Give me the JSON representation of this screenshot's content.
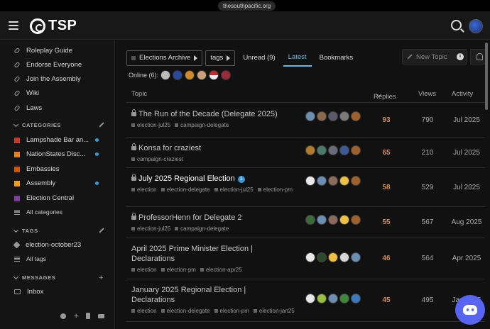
{
  "browser": {
    "url": "thesouthpacific.org"
  },
  "header": {
    "logo_text": "TSP"
  },
  "sidebar": {
    "links": [
      "Roleplay Guide",
      "Endorse Everyone",
      "Join the Assembly",
      "Wiki",
      "Laws"
    ],
    "categories_heading": "CATEGORIES",
    "categories": [
      {
        "label": "Lampshade Bar an...",
        "color": "#c0392b",
        "dot": true
      },
      {
        "label": "NationStates Disc...",
        "color": "#e67e22",
        "dot": true
      },
      {
        "label": "Embassies",
        "color": "#d35400",
        "dot": false
      },
      {
        "label": "Assembly",
        "color": "#f39c12",
        "dot": true
      },
      {
        "label": "Election Central",
        "color": "#7d3c98",
        "dot": false
      }
    ],
    "all_categories": "All categories",
    "tags_heading": "TAGS",
    "tags": [
      "election-october23"
    ],
    "all_tags": "All tags",
    "messages_heading": "MESSAGES",
    "inbox": "Inbox"
  },
  "nav": {
    "category_dropdown": "Elections Archive",
    "tags_dropdown": "tags",
    "tabs": [
      "Unread (9)",
      "Latest",
      "Bookmarks"
    ],
    "active_tab": "Latest",
    "new_topic": "New Topic"
  },
  "online": {
    "label": "Online (6):"
  },
  "table": {
    "headers": {
      "topic": "Topic",
      "replies": "Replies",
      "views": "Views",
      "activity": "Activity"
    },
    "rows": [
      {
        "title": "The Run of the Decade (Delegate 2025)",
        "locked": true,
        "bold": false,
        "badge": "",
        "tags": [
          "election-jul25",
          "campaign-delegate"
        ],
        "replies": "93",
        "views": "790",
        "activity": "Jul 2025",
        "posters": [
          "#6b8fb3",
          "#8a6a4a",
          "#5a5a6a",
          "#7a7a7a",
          "#a0602a"
        ]
      },
      {
        "title": "Konsa for craziest",
        "locked": true,
        "bold": false,
        "badge": "",
        "tags": [
          "campaign-craziest"
        ],
        "replies": "65",
        "views": "210",
        "activity": "Jul 2025",
        "posters": [
          "#b07a2a",
          "#4a7a6a",
          "#6a6a7a",
          "#3a5a9a",
          "#a0602a"
        ]
      },
      {
        "title": "July 2025 Regional Election",
        "locked": true,
        "bold": true,
        "badge": "1",
        "tags": [
          "election",
          "election-delegate",
          "election-jul25",
          "election-pm"
        ],
        "replies": "58",
        "views": "529",
        "activity": "Jul 2025",
        "posters": [
          "#e8e8e8",
          "#6b8fb3",
          "#8a6a5a",
          "#f0c040",
          "#a0602a"
        ]
      },
      {
        "title": "ProfessorHenn for Delegate 2",
        "locked": true,
        "bold": false,
        "badge": "",
        "tags": [
          "election-jul25",
          "campaign-delegate"
        ],
        "replies": "55",
        "views": "567",
        "activity": "Aug 2025",
        "posters": [
          "#3a6a3a",
          "#6b8fb3",
          "#8a6a5a",
          "#f0c040",
          "#a0602a"
        ]
      },
      {
        "title": "April 2025 Prime Minister Election | Declarations",
        "locked": false,
        "bold": false,
        "badge": "",
        "tags": [
          "election",
          "election-pm",
          "election-apr25"
        ],
        "replies": "46",
        "views": "564",
        "activity": "Apr 2025",
        "posters": [
          "#e8e8e8",
          "#2a4a2a",
          "#f0c040",
          "#d8d8d8",
          "#6b8fb3"
        ]
      },
      {
        "title": "January 2025 Regional Election | Declarations",
        "locked": false,
        "bold": false,
        "badge": "",
        "tags": [
          "election",
          "election-delegate",
          "election-pm",
          "election-jan25"
        ],
        "replies": "45",
        "views": "495",
        "activity": "Jan 2025",
        "posters": [
          "#e8e8e8",
          "#9ac040",
          "#6b8fb3",
          "#3a8a3a",
          "#3a7ac0"
        ]
      }
    ]
  }
}
